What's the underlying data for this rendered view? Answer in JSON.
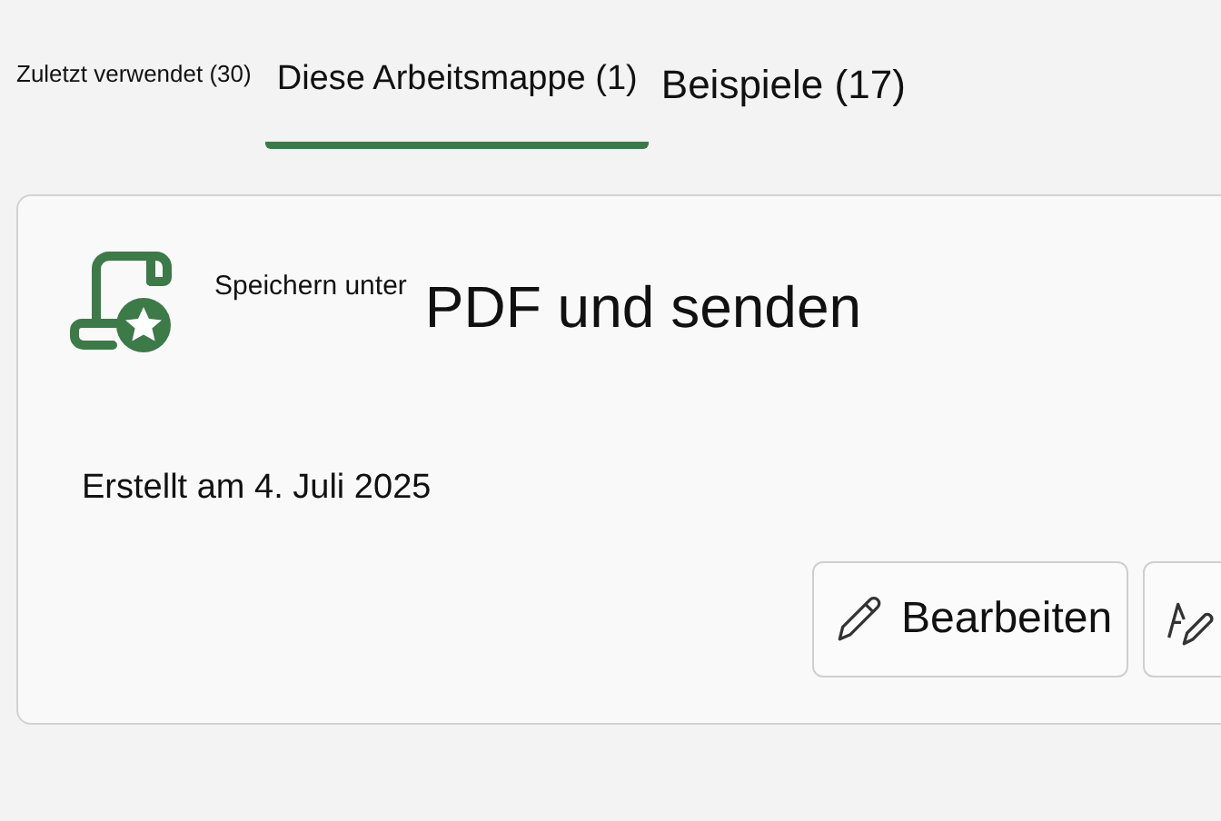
{
  "tabs": [
    {
      "label": "Zuletzt verwendet (30)",
      "selected": false
    },
    {
      "label": "Diese Arbeitsmappe (1)",
      "selected": true
    },
    {
      "label": "Beispiele (17)",
      "selected": false
    }
  ],
  "card": {
    "prefix": "Speichern unter",
    "title": "PDF und senden",
    "created": "Erstellt am 4. Juli 2025",
    "buttons": [
      {
        "kind": "edit",
        "label": "Bearbeiten"
      },
      {
        "kind": "draw"
      }
    ]
  }
}
